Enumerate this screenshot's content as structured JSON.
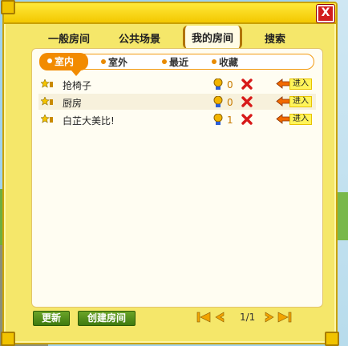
{
  "main_tabs": [
    {
      "label": "一般房间",
      "active": false
    },
    {
      "label": "公共场景",
      "active": false
    },
    {
      "label": "我的房间",
      "active": true
    },
    {
      "label": "搜索",
      "active": false
    }
  ],
  "sub_tabs": [
    {
      "label": "室内",
      "active": true
    },
    {
      "label": "室外",
      "active": false
    },
    {
      "label": "最近",
      "active": false
    },
    {
      "label": "收藏",
      "active": false
    }
  ],
  "rooms": [
    {
      "name": "抢椅子",
      "count": "0",
      "enter_label": "进入"
    },
    {
      "name": "厨房",
      "count": "0",
      "enter_label": "进入"
    },
    {
      "name": "白芷大美比!",
      "count": "1",
      "enter_label": "进入"
    }
  ],
  "buttons": {
    "refresh_label": "更新",
    "create_label": "创建房间",
    "close_label": "X"
  },
  "pagination": {
    "text": "1/1"
  },
  "colors": {
    "accent": "#f28b00",
    "frame": "#f5e76a",
    "button_green": "#4f8a18",
    "close_red": "#d21d1d"
  }
}
